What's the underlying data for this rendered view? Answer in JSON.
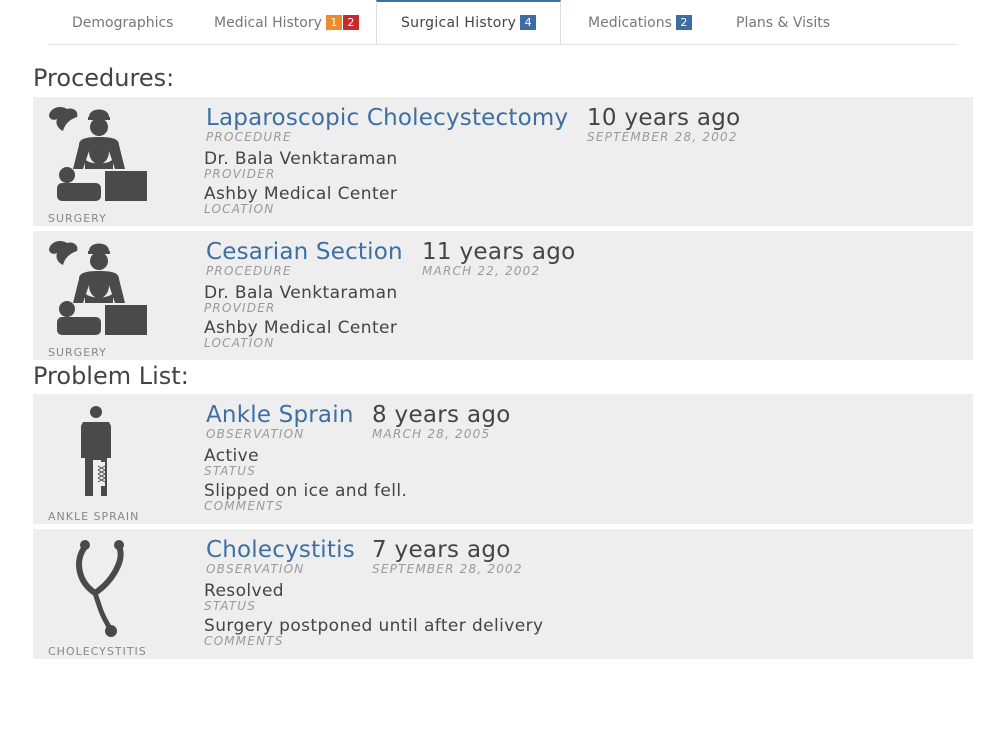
{
  "tabs": [
    {
      "label": "Demographics",
      "badges": []
    },
    {
      "label": "Medical History",
      "badges": [
        "1",
        "2"
      ]
    },
    {
      "label": "Surgical History",
      "badges": [
        "4"
      ]
    },
    {
      "label": "Medications",
      "badges": [
        "2"
      ]
    },
    {
      "label": "Plans & Visits",
      "badges": []
    }
  ],
  "colors": {
    "accent": "#3d6fa3",
    "badge_orange": "#ef8a2a",
    "badge_red": "#c62b2b",
    "badge_blue": "#3f6da3",
    "card_bg": "#eeeeee"
  },
  "procedures_title": "Procedures:",
  "procedures": [
    {
      "icon": "surgeon-icon",
      "icon_label": "SURGERY",
      "title": "Laparoscopic Cholecystectomy",
      "title_type": "PROCEDURE",
      "relative": "10 years ago",
      "date": "SEPTEMBER 28, 2002",
      "provider": "Dr. Bala Venktaraman",
      "provider_label": "PROVIDER",
      "location": "Ashby Medical Center",
      "location_label": "LOCATION"
    },
    {
      "icon": "surgeon-icon",
      "icon_label": "SURGERY",
      "title": "Cesarian Section",
      "title_type": "PROCEDURE",
      "relative": "11 years ago",
      "date": "MARCH 22, 2002",
      "provider": "Dr. Bala Venktaraman",
      "provider_label": "PROVIDER",
      "location": "Ashby Medical Center",
      "location_label": "LOCATION"
    }
  ],
  "problems_title": "Problem List:",
  "problems": [
    {
      "icon": "crutch-person-icon",
      "icon_label": "ANKLE SPRAIN",
      "title": "Ankle Sprain",
      "title_type": "OBSERVATION",
      "relative": "8 years ago",
      "date": "MARCH 28, 2005",
      "status": "Active",
      "status_label": "STATUS",
      "comments": "Slipped on ice and fell.",
      "comments_label": "COMMENTS"
    },
    {
      "icon": "stethoscope-icon",
      "icon_label": "CHOLECYSTITIS",
      "title": "Cholecystitis",
      "title_type": "OBSERVATION",
      "relative": "7 years ago",
      "date": "SEPTEMBER 28, 2002",
      "status": "Resolved",
      "status_label": "STATUS",
      "comments": "Surgery postponed until after delivery",
      "comments_label": "COMMENTS"
    }
  ]
}
